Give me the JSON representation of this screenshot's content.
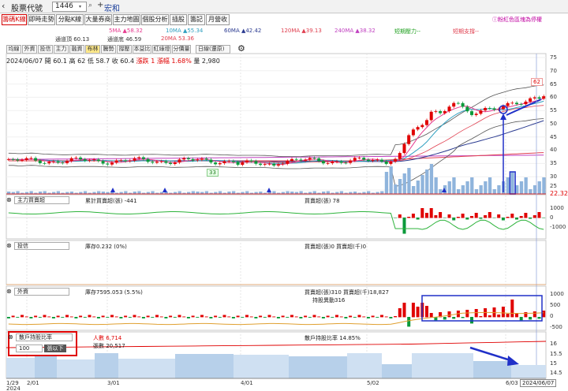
{
  "topbar": {
    "back": "‹",
    "label": "股票代號",
    "code": "1446",
    "name": "宏和",
    "dropdown": "▾",
    "search_icon": "🔍",
    "plus": "+"
  },
  "tabs": [
    "籌碼K線",
    "即時走勢",
    "分點K線",
    "大量券商",
    "主力地圖",
    "個股分析",
    "插股",
    "籌記",
    "月營收"
  ],
  "hint": "粉紅色區塊為停權",
  "ma": {
    "ma5": "5MA ▲58.32",
    "ma10": "10MA ▲55.34",
    "ma60": "60MA ▲42.42",
    "ma120": "120MA ▲39.13",
    "ma240": "240MA ▲38.32",
    "short_pressure": "短期壓力--",
    "short_support": "短期支撐--",
    "upper": "通道頂 60.13",
    "mid": "通道底 46.59",
    "ma20": "20MA 53.36"
  },
  "toolbar": [
    "均線",
    "外資",
    "投信",
    "主力",
    "融資",
    "布林",
    "騰勢",
    "撐壓",
    "本益比",
    "紅綠燈",
    "分價量",
    "日線(還原)"
  ],
  "info": {
    "date": "2024/06/07",
    "open": "開 60.1",
    "high": "高 62",
    "low": "低 58.7",
    "close": "收 60.4",
    "change": "漲跌 1",
    "pct": "漲幅 1.68%",
    "vol": "量 2,980"
  },
  "price_axis": [
    "75",
    "70",
    "65",
    "60",
    "55",
    "50",
    "45",
    "40",
    "35",
    "30",
    "25"
  ],
  "annotations": {
    "peak": "62",
    "low": "33",
    "last_price": "22.32"
  },
  "panels": {
    "main_force": {
      "select": "主力買賣超",
      "cum": "累計買賣超(張) -441",
      "net": "買賣超(張) 78",
      "axis": [
        "1000",
        "0",
        "-1000"
      ]
    },
    "trust": {
      "select": "投信",
      "stock": "庫存0.232 (0%)",
      "net": "買賣超(張)0 買賣超(千)0"
    },
    "foreign": {
      "select": "外資",
      "stock": "庫存7595.053 (5.5%)",
      "net": "買賣超(張)310 買賣超(千)18,827",
      "hold": "持股異動316",
      "axis": [
        "1000",
        "500",
        "0",
        "-500"
      ]
    },
    "holders": {
      "select": "散戶持股比率",
      "level": "100",
      "unit": "張以下",
      "people": "人數 6,714",
      "avg": "張數 20,517",
      "ratio": "散戶持股比率 14.85%",
      "axis": [
        "16",
        "15.5",
        "15",
        "14.5"
      ]
    }
  },
  "xaxis": [
    "1/29",
    "2/01",
    "3/01",
    "4/01",
    "5/02",
    "6/03"
  ],
  "xyear": "2024",
  "cursor_date": "2024/06/07",
  "colors": {
    "up": "#e00000",
    "down": "#0a9a3a",
    "accent": "#2030c8",
    "bar": "#8fb4dc"
  }
}
